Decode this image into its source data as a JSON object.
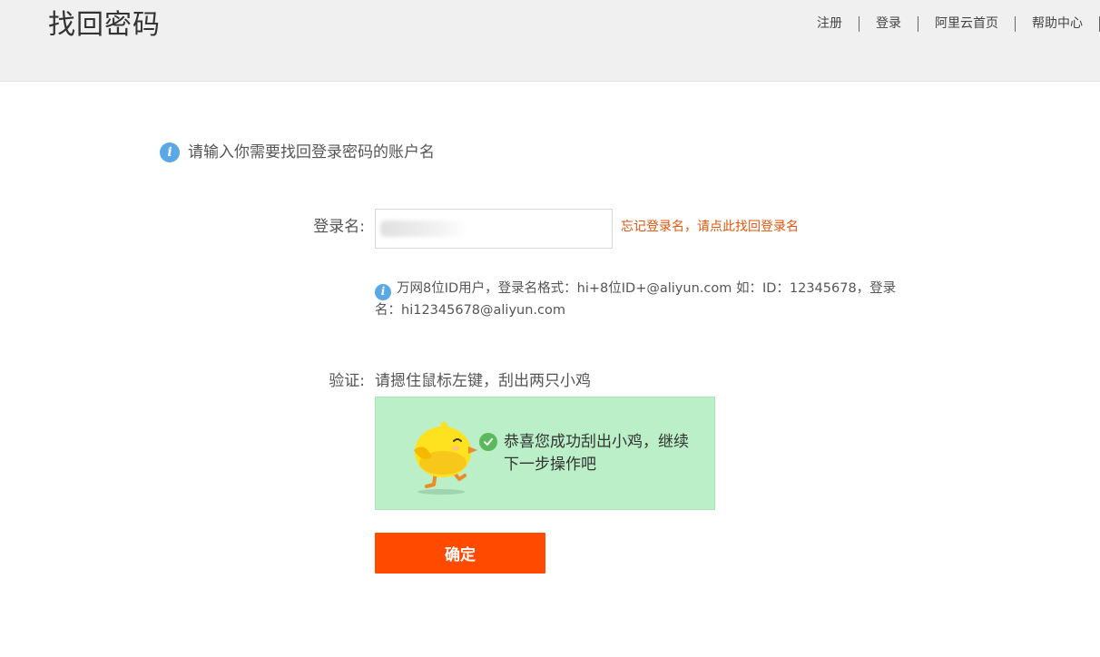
{
  "header": {
    "title": "找回密码",
    "nav": [
      {
        "label": "注册"
      },
      {
        "label": "登录"
      },
      {
        "label": "阿里云首页"
      },
      {
        "label": "帮助中心"
      }
    ]
  },
  "tip": {
    "icon": "info-icon",
    "text": "请输入你需要找回登录密码的账户名"
  },
  "login": {
    "label": "登录名:",
    "value": "",
    "forgot_link": "忘记登录名，请点此找回登录名"
  },
  "hint": {
    "icon": "info-icon",
    "text": "万网8位ID用户，登录名格式：hi+8位ID+@aliyun.com 如：ID：12345678，登录名：hi12345678@aliyun.com"
  },
  "verify": {
    "label": "验证:",
    "instruction": "请摁住鼠标左键，刮出两只小鸡",
    "success_icon": "check-circle-icon",
    "success_text": "恭喜您成功刮出小鸡，继续下一步操作吧"
  },
  "submit_label": "确定",
  "colors": {
    "header_bg": "#f0f0f0",
    "accent": "#ff4a00",
    "link": "#e0560c",
    "info": "#5aa9e6",
    "success_bg": "#baefc8",
    "success_check": "#5cb85c"
  }
}
